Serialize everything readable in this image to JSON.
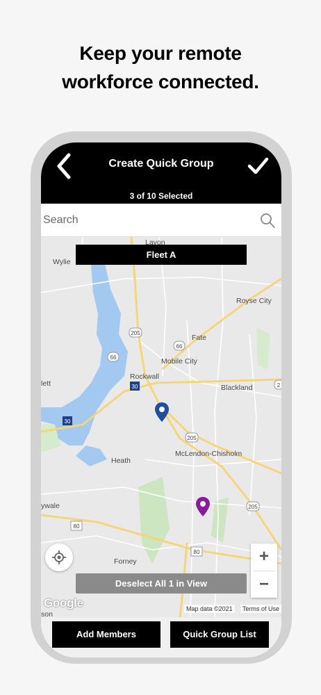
{
  "headline": {
    "line1": "Keep your remote",
    "line2": "workforce connected."
  },
  "app": {
    "title": "Create Quick Group",
    "subtitle": "3 of 10 Selected",
    "search": {
      "placeholder": "Search",
      "value": ""
    },
    "fleet_label": "Fleet A",
    "deselect_label": "Deselect All 1 in View",
    "zoom": {
      "in_label": "+",
      "out_label": "−"
    },
    "google_logo": "Google",
    "map_data_text": "Map data ©2021",
    "terms_text": "Terms of Use",
    "buttons": {
      "add_members": "Add Members",
      "quick_group_list": "Quick Group List"
    },
    "pins": [
      {
        "name": "pin-blue",
        "color": "#1f4f9c"
      },
      {
        "name": "pin-purple",
        "color": "#8b1a9c"
      }
    ]
  },
  "map": {
    "places": [
      "Lavon",
      "Wylie",
      "Royse City",
      "Fate",
      "Mobile City",
      "Rockwall",
      "Blackland",
      "lett",
      "McLendon-Chisholm",
      "Heath",
      "ywale",
      "Forney",
      "son"
    ],
    "shields": [
      "205",
      "66",
      "66",
      "30",
      "30",
      "205",
      "205",
      "80",
      "80",
      "2"
    ]
  },
  "colors": {
    "accent": "#000000",
    "water": "#a3c9f0",
    "road": "#f6d57a",
    "park": "#cde6c2"
  }
}
